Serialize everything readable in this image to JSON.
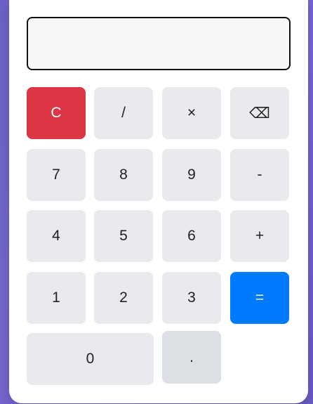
{
  "display": {
    "value": "",
    "placeholder": ""
  },
  "keys": {
    "clear": "C",
    "divide": "/",
    "multiply": "×",
    "backspace": "⌫",
    "seven": "7",
    "eight": "8",
    "nine": "9",
    "subtract": "-",
    "four": "4",
    "five": "5",
    "six": "6",
    "add": "+",
    "one": "1",
    "two": "2",
    "three": "3",
    "equals": "=",
    "zero": "0",
    "decimal": "."
  },
  "colors": {
    "clear": "#dc3545",
    "equals": "#007bff",
    "key": "#e8eaed",
    "background": "#6b63c9"
  }
}
